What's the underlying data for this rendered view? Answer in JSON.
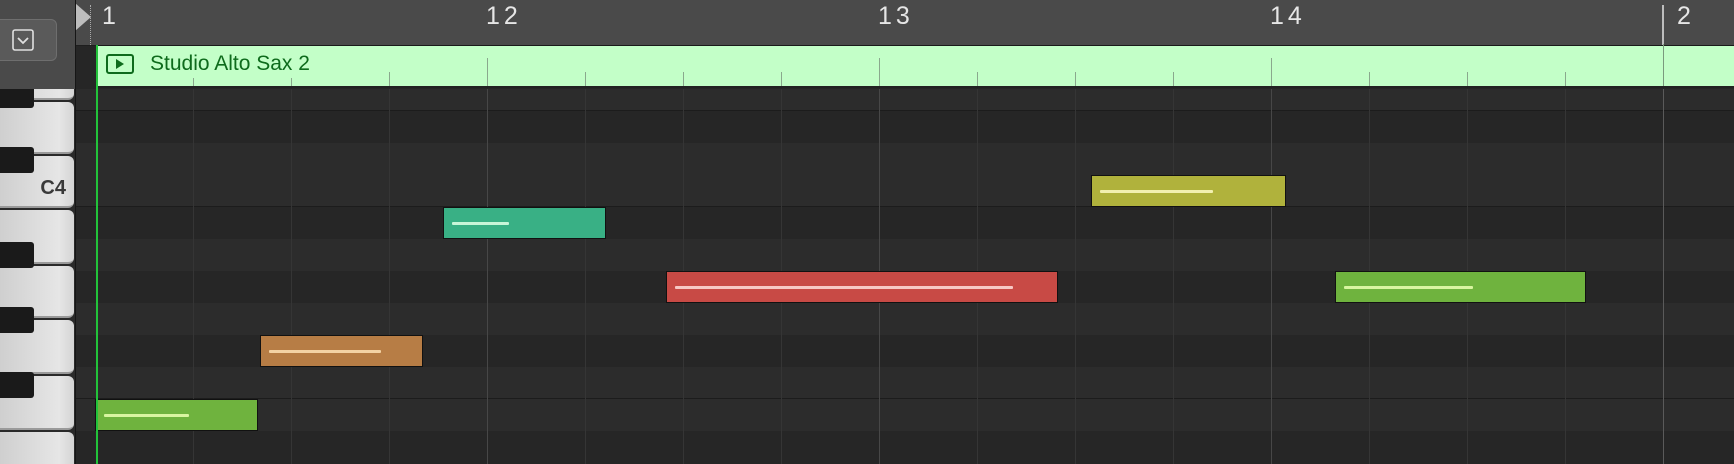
{
  "ruler": {
    "numbers": [
      "1",
      "12",
      "13",
      "14",
      "2"
    ]
  },
  "region": {
    "title": "Studio Alto Sax 2",
    "color": "#c3ffc8",
    "text_color": "#0e6b1c"
  },
  "keyboard": {
    "label_c4": "C4",
    "dropdown_icon": "chevron-down-box-icon"
  },
  "notes": [
    {
      "name": "note-1",
      "color": "#6fb33e",
      "velocity_color": "#d8f5a0",
      "velocity": 0.58
    },
    {
      "name": "note-2",
      "color": "#b77d45",
      "velocity_color": "#f3d2a4",
      "velocity": 0.76
    },
    {
      "name": "note-3",
      "color": "#39b085",
      "velocity_color": "#c8f5d8",
      "velocity": 0.39
    },
    {
      "name": "note-4",
      "color": "#c84a45",
      "velocity_color": "#f7c8c4",
      "velocity": 0.9
    },
    {
      "name": "note-5",
      "color": "#b0b23c",
      "velocity_color": "#f2f0b0",
      "velocity": 0.63
    },
    {
      "name": "note-6",
      "color": "#6fb33e",
      "velocity_color": "#d8f5a0",
      "velocity": 0.55
    }
  ],
  "colors": {
    "background": "#262626",
    "playhead": "#22c33a"
  }
}
